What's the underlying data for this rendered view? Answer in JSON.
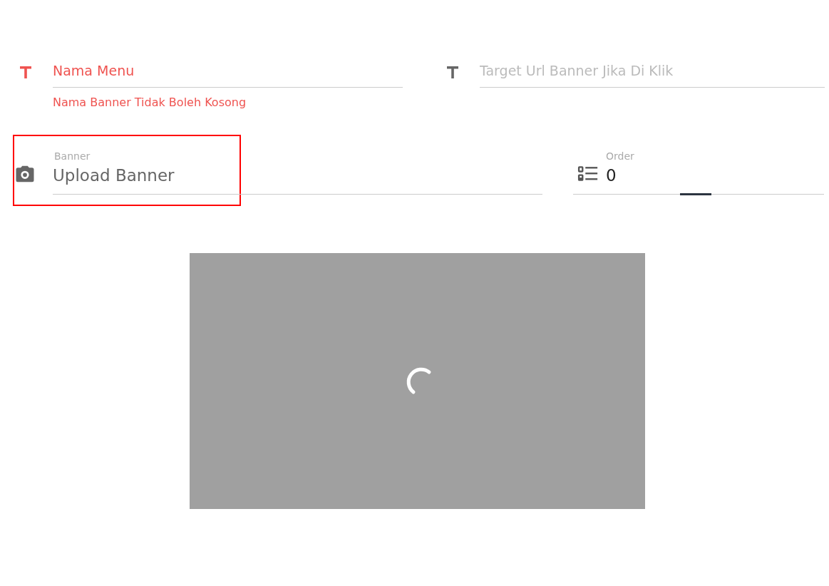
{
  "fields_row_1": [
    {
      "placeholder": "Nama Menu",
      "error": true,
      "error_message": "Nama Banner Tidak Boleh Kosong"
    },
    {
      "placeholder": "Target Url Banner Jika Di Klik",
      "error": false
    }
  ],
  "fields_row_2": [
    {
      "kind": "upload",
      "label": "Banner",
      "value": "Upload Banner",
      "highlighted": true,
      "focused": false
    },
    {
      "kind": "number",
      "label": "Order",
      "value": "0",
      "highlighted": false,
      "focused": true
    }
  ],
  "preview": {
    "loading": true
  }
}
